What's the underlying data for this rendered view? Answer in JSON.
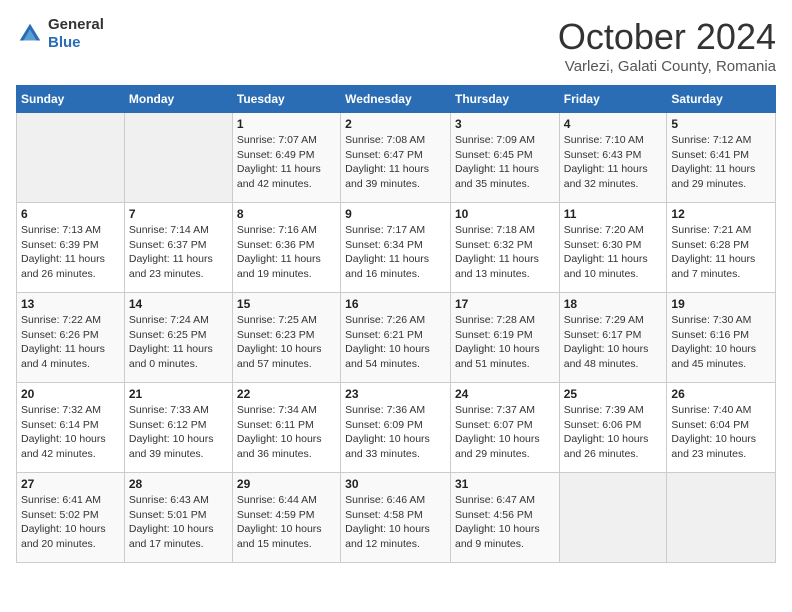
{
  "header": {
    "logo_general": "General",
    "logo_blue": "Blue",
    "title": "October 2024",
    "location": "Varlezi, Galati County, Romania"
  },
  "days_of_week": [
    "Sunday",
    "Monday",
    "Tuesday",
    "Wednesday",
    "Thursday",
    "Friday",
    "Saturday"
  ],
  "weeks": [
    [
      {
        "day": "",
        "info": ""
      },
      {
        "day": "",
        "info": ""
      },
      {
        "day": "1",
        "info": "Sunrise: 7:07 AM\nSunset: 6:49 PM\nDaylight: 11 hours and 42 minutes."
      },
      {
        "day": "2",
        "info": "Sunrise: 7:08 AM\nSunset: 6:47 PM\nDaylight: 11 hours and 39 minutes."
      },
      {
        "day": "3",
        "info": "Sunrise: 7:09 AM\nSunset: 6:45 PM\nDaylight: 11 hours and 35 minutes."
      },
      {
        "day": "4",
        "info": "Sunrise: 7:10 AM\nSunset: 6:43 PM\nDaylight: 11 hours and 32 minutes."
      },
      {
        "day": "5",
        "info": "Sunrise: 7:12 AM\nSunset: 6:41 PM\nDaylight: 11 hours and 29 minutes."
      }
    ],
    [
      {
        "day": "6",
        "info": "Sunrise: 7:13 AM\nSunset: 6:39 PM\nDaylight: 11 hours and 26 minutes."
      },
      {
        "day": "7",
        "info": "Sunrise: 7:14 AM\nSunset: 6:37 PM\nDaylight: 11 hours and 23 minutes."
      },
      {
        "day": "8",
        "info": "Sunrise: 7:16 AM\nSunset: 6:36 PM\nDaylight: 11 hours and 19 minutes."
      },
      {
        "day": "9",
        "info": "Sunrise: 7:17 AM\nSunset: 6:34 PM\nDaylight: 11 hours and 16 minutes."
      },
      {
        "day": "10",
        "info": "Sunrise: 7:18 AM\nSunset: 6:32 PM\nDaylight: 11 hours and 13 minutes."
      },
      {
        "day": "11",
        "info": "Sunrise: 7:20 AM\nSunset: 6:30 PM\nDaylight: 11 hours and 10 minutes."
      },
      {
        "day": "12",
        "info": "Sunrise: 7:21 AM\nSunset: 6:28 PM\nDaylight: 11 hours and 7 minutes."
      }
    ],
    [
      {
        "day": "13",
        "info": "Sunrise: 7:22 AM\nSunset: 6:26 PM\nDaylight: 11 hours and 4 minutes."
      },
      {
        "day": "14",
        "info": "Sunrise: 7:24 AM\nSunset: 6:25 PM\nDaylight: 11 hours and 0 minutes."
      },
      {
        "day": "15",
        "info": "Sunrise: 7:25 AM\nSunset: 6:23 PM\nDaylight: 10 hours and 57 minutes."
      },
      {
        "day": "16",
        "info": "Sunrise: 7:26 AM\nSunset: 6:21 PM\nDaylight: 10 hours and 54 minutes."
      },
      {
        "day": "17",
        "info": "Sunrise: 7:28 AM\nSunset: 6:19 PM\nDaylight: 10 hours and 51 minutes."
      },
      {
        "day": "18",
        "info": "Sunrise: 7:29 AM\nSunset: 6:17 PM\nDaylight: 10 hours and 48 minutes."
      },
      {
        "day": "19",
        "info": "Sunrise: 7:30 AM\nSunset: 6:16 PM\nDaylight: 10 hours and 45 minutes."
      }
    ],
    [
      {
        "day": "20",
        "info": "Sunrise: 7:32 AM\nSunset: 6:14 PM\nDaylight: 10 hours and 42 minutes."
      },
      {
        "day": "21",
        "info": "Sunrise: 7:33 AM\nSunset: 6:12 PM\nDaylight: 10 hours and 39 minutes."
      },
      {
        "day": "22",
        "info": "Sunrise: 7:34 AM\nSunset: 6:11 PM\nDaylight: 10 hours and 36 minutes."
      },
      {
        "day": "23",
        "info": "Sunrise: 7:36 AM\nSunset: 6:09 PM\nDaylight: 10 hours and 33 minutes."
      },
      {
        "day": "24",
        "info": "Sunrise: 7:37 AM\nSunset: 6:07 PM\nDaylight: 10 hours and 29 minutes."
      },
      {
        "day": "25",
        "info": "Sunrise: 7:39 AM\nSunset: 6:06 PM\nDaylight: 10 hours and 26 minutes."
      },
      {
        "day": "26",
        "info": "Sunrise: 7:40 AM\nSunset: 6:04 PM\nDaylight: 10 hours and 23 minutes."
      }
    ],
    [
      {
        "day": "27",
        "info": "Sunrise: 6:41 AM\nSunset: 5:02 PM\nDaylight: 10 hours and 20 minutes."
      },
      {
        "day": "28",
        "info": "Sunrise: 6:43 AM\nSunset: 5:01 PM\nDaylight: 10 hours and 17 minutes."
      },
      {
        "day": "29",
        "info": "Sunrise: 6:44 AM\nSunset: 4:59 PM\nDaylight: 10 hours and 15 minutes."
      },
      {
        "day": "30",
        "info": "Sunrise: 6:46 AM\nSunset: 4:58 PM\nDaylight: 10 hours and 12 minutes."
      },
      {
        "day": "31",
        "info": "Sunrise: 6:47 AM\nSunset: 4:56 PM\nDaylight: 10 hours and 9 minutes."
      },
      {
        "day": "",
        "info": ""
      },
      {
        "day": "",
        "info": ""
      }
    ]
  ]
}
